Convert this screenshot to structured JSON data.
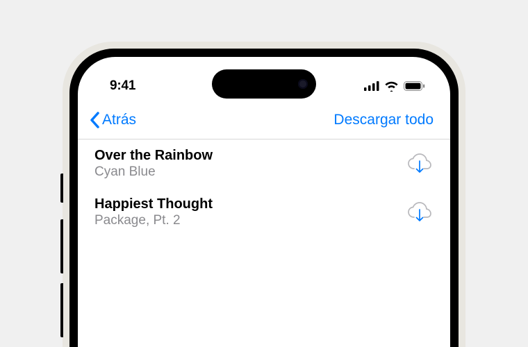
{
  "status": {
    "time": "9:41"
  },
  "nav": {
    "back_label": "Atrás",
    "action_label": "Descargar todo"
  },
  "items": [
    {
      "title": "Over the Rainbow",
      "subtitle": "Cyan Blue"
    },
    {
      "title": "Happiest Thought",
      "subtitle": "Package, Pt. 2"
    }
  ]
}
